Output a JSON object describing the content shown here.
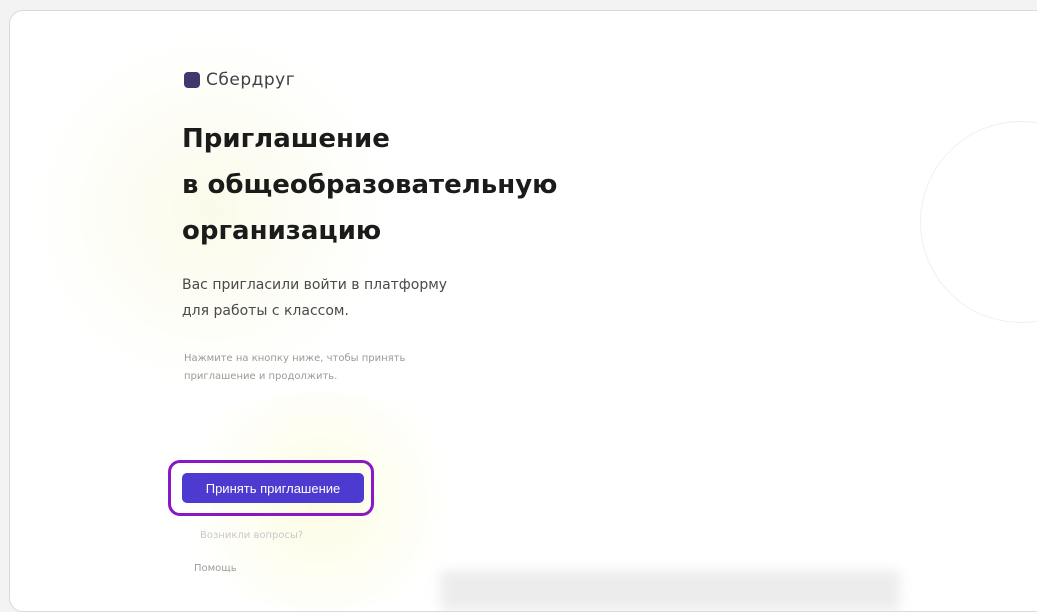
{
  "logo": {
    "text": "Сбердруг",
    "icon": "logo-icon"
  },
  "headline": {
    "line1": "Приглашение",
    "line2": "в общеобразовательную",
    "line3": "организацию"
  },
  "subtitle": {
    "line1": "Вас пригласили войти в платформу",
    "line2": "для работы с классом."
  },
  "note": {
    "line1": "Нажмите на кнопку ниже, чтобы принять",
    "line2": "приглашение и продолжить."
  },
  "primary_button": {
    "label": "Принять приглашение"
  },
  "footer": {
    "line": "Возникли вопросы?",
    "link": "Помощь"
  },
  "colors": {
    "button": "#4d3ad0",
    "highlight": "#8a17c5",
    "logo": "#3e3a70"
  }
}
